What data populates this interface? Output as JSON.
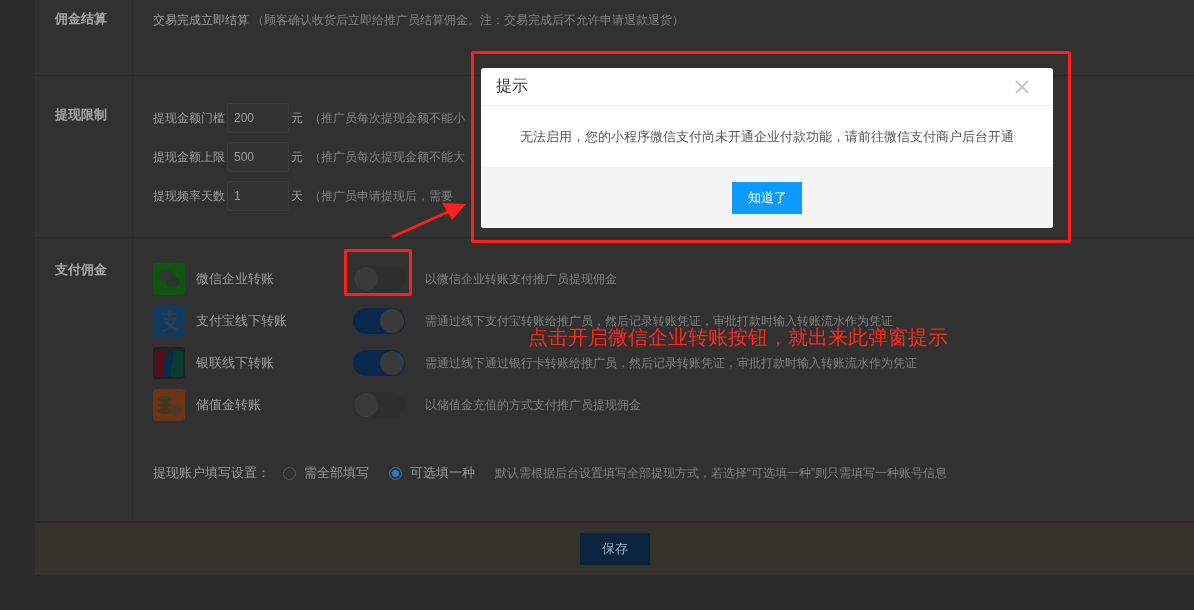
{
  "settlement": {
    "label": "佣金结算",
    "option": "交易完成立即结算",
    "hint": "（顾客确认收货后立即给推广员结算佣金。注：交易完成后不允许申请退款退货）"
  },
  "limits": {
    "label": "提现限制",
    "rows": [
      {
        "label": "提现金额门槛",
        "value": "200",
        "unit": "元",
        "hint": "（推广员每次提现金额不能小"
      },
      {
        "label": "提现金额上限",
        "value": "500",
        "unit": "元",
        "hint": "（推广员每次提现金额不能大"
      },
      {
        "label": "提现频率天数",
        "value": "1",
        "unit": "天",
        "hint": "（推广员申请提现后，需要"
      }
    ]
  },
  "payment": {
    "label": "支付佣金",
    "methods": [
      {
        "kind": "wechat",
        "name": "微信企业转账",
        "on": false,
        "description": "以微信企业转账支付推广员提现佣金"
      },
      {
        "kind": "alipay",
        "name": "支付宝线下转账",
        "on": true,
        "description": "需通过线下支付宝转账给推广员，然后记录转账凭证，审批打款时输入转账流水作为凭证"
      },
      {
        "kind": "unionpay",
        "name": "银联线下转账",
        "on": true,
        "description": "需通过线下通过银行卡转账给推广员，然后记录转账凭证，审批打款时输入转账流水作为凭证"
      },
      {
        "kind": "balance",
        "name": "储值金转账",
        "on": false,
        "description": "以储值金充值的方式支付推广员提现佣金"
      }
    ]
  },
  "account_setting": {
    "label": "提现账户填写设置：",
    "options": [
      {
        "label": "需全部填写",
        "selected": false
      },
      {
        "label": "可选填一种",
        "selected": true
      }
    ],
    "hint": "默认需根据后台设置填写全部提现方式，若选择“可选填一种”则只需填写一种账号信息"
  },
  "save_button": "保存",
  "dialog": {
    "title": "提示",
    "message": "无法启用，您的小程序微信支付尚未开通企业付款功能，请前往微信支付商户后台开通",
    "button": "知道了"
  },
  "annotation": {
    "text": "点击开启微信企业转账按钮，就出来此弹窗提示"
  }
}
